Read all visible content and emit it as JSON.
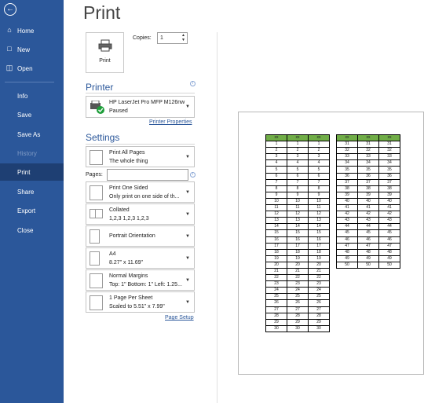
{
  "nav": {
    "back_icon": "back-arrow-icon",
    "items": [
      {
        "label": "Home",
        "icon": "home-icon"
      },
      {
        "label": "New",
        "icon": "new-doc-icon"
      },
      {
        "label": "Open",
        "icon": "open-folder-icon"
      },
      {
        "label": "Info"
      },
      {
        "label": "Save"
      },
      {
        "label": "Save As"
      },
      {
        "label": "History"
      },
      {
        "label": "Print"
      },
      {
        "label": "Share"
      },
      {
        "label": "Export"
      },
      {
        "label": "Close"
      }
    ],
    "active": "Print",
    "accent": "#2b579a"
  },
  "title": "Print",
  "print_button": {
    "label": "Print"
  },
  "copies": {
    "label": "Copies:",
    "value": "1"
  },
  "printer": {
    "heading": "Printer",
    "name": "HP LaserJet Pro MFP M126nw",
    "status": "Paused",
    "properties_link": "Printer Properties"
  },
  "settings": {
    "heading": "Settings",
    "print_range": {
      "line1": "Print All Pages",
      "line2": "The whole thing"
    },
    "pages_label": "Pages:",
    "pages_value": "",
    "sides": {
      "line1": "Print One Sided",
      "line2": "Only print on one side of th..."
    },
    "collation": {
      "line1": "Collated",
      "line2": "1,2,3    1,2,3    1,2,3"
    },
    "orientation": {
      "line1": "Portrait Orientation",
      "line2": ""
    },
    "paper": {
      "line1": "A4",
      "line2": "8.27\" x 11.69\""
    },
    "margins": {
      "line1": "Normal Margins",
      "line2": "Top: 1\" Bottom: 1\" Left: 1.25..."
    },
    "per_sheet": {
      "line1": "1 Page Per Sheet",
      "line2": "Scaled to 5.51\" x 7.99\""
    },
    "page_setup_link": "Page Setup"
  },
  "preview": {
    "header": [
      "xx",
      "xx",
      "xx"
    ],
    "header_color": "#70ad47",
    "table1_rows": [
      1,
      2,
      3,
      4,
      5,
      6,
      7,
      8,
      9,
      10,
      11,
      12,
      13,
      14,
      15,
      16,
      17,
      18,
      19,
      20,
      21,
      22,
      23,
      24,
      25,
      26,
      27,
      28,
      29,
      30
    ],
    "table2_rows": [
      31,
      32,
      33,
      34,
      35,
      36,
      37,
      38,
      39,
      40,
      41,
      42,
      43,
      44,
      45,
      46,
      47,
      48,
      49,
      50
    ]
  }
}
